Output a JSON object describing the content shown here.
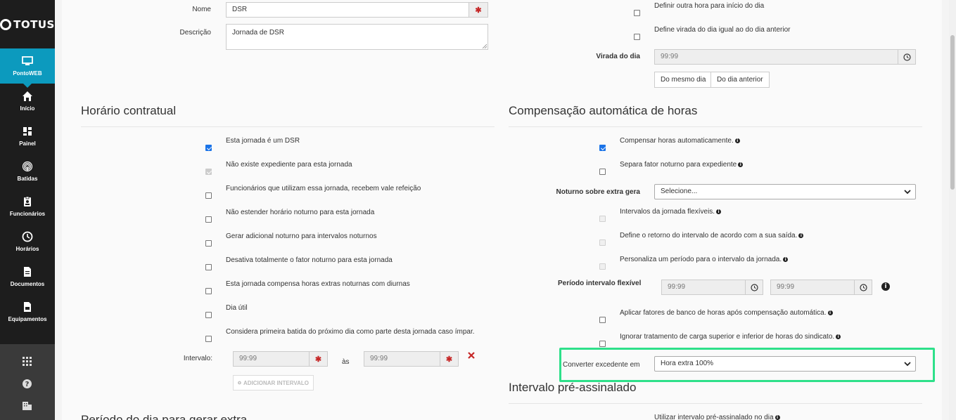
{
  "brand": {
    "name": "TOTUS"
  },
  "sidebar": {
    "active": {
      "label": "PontoWEB",
      "icon": "monitor-icon"
    },
    "items": [
      {
        "label": "Início",
        "icon": "home-icon"
      },
      {
        "label": "Painel",
        "icon": "dashboard-icon"
      },
      {
        "label": "Batidas",
        "icon": "fingerprint-icon"
      },
      {
        "label": "Funcionários",
        "icon": "id-badge-icon"
      },
      {
        "label": "Horários",
        "icon": "clock-icon"
      },
      {
        "label": "Documentos",
        "icon": "document-icon"
      },
      {
        "label": "Equipamentos",
        "icon": "equipment-icon"
      }
    ],
    "bottom_icons": [
      "apps-grid-icon",
      "help-icon",
      "building-icon"
    ]
  },
  "form": {
    "nome_label": "Nome",
    "nome_value": "DSR",
    "descricao_label": "Descrição",
    "descricao_value": "Jornada de DSR"
  },
  "top_right": {
    "cb1_label": "Definir outra hora para início do dia",
    "cb2_label": "Define virada do dia igual ao do dia anterior",
    "virada_label": "Virada do dia",
    "virada_placeholder": "99:99",
    "btn_mesmo_dia": "Do mesmo dia",
    "btn_dia_anterior": "Do dia anterior"
  },
  "horario": {
    "title": "Horário contratual",
    "options": [
      "Esta jornada é um DSR",
      "Não existe expediente para esta jornada",
      "Funcionários que utilizam essa jornada, recebem vale refeição",
      "Não estender horário noturno para esta jornada",
      "Gerar adicional noturno para intervalos noturnos",
      "Desativa totalmente o fator noturno para esta jornada",
      "Esta jornada compensa horas extras noturnas com diurnas",
      "Dia útil",
      "Considera primeira batida do próximo dia como parte desta jornada caso ímpar."
    ],
    "intervalo_label": "Intervalo:",
    "intervalo_placeholder": "99:99",
    "as_label": "às",
    "add_intervalo": "ADICIONAR INTERVALO",
    "next_title": "Período do dia para gerar extra"
  },
  "compensacao": {
    "title": "Compensação automática de horas",
    "opt1": "Compensar horas automaticamente.",
    "opt2": "Separa fator noturno para expediente",
    "noturno_label": "Noturno sobre extra gera",
    "noturno_value": "Selecione...",
    "opt3": "Intervalos da jornada flexíveis.",
    "opt4": "Define o retorno do intervalo de acordo com a sua saída.",
    "opt5": "Personaliza um período para o intervalo da jornada.",
    "periodo_label": "Período intervalo flexível",
    "periodo_placeholder": "99:99",
    "opt6": "Aplicar fatores de banco de horas após compensação automática.",
    "opt7": "Ignorar tratamento de carga superior e inferior de horas do sindicato.",
    "converter_label": "Converter excedente em",
    "converter_value": "Hora extra 100%"
  },
  "intervalo_pre": {
    "title": "Intervalo pré-assinalado",
    "opt1": "Utilizar intervalo pré-assinalado no dia"
  },
  "colors": {
    "accent": "#0c9abe",
    "highlight": "#2ee08a",
    "required": "#c62828"
  }
}
